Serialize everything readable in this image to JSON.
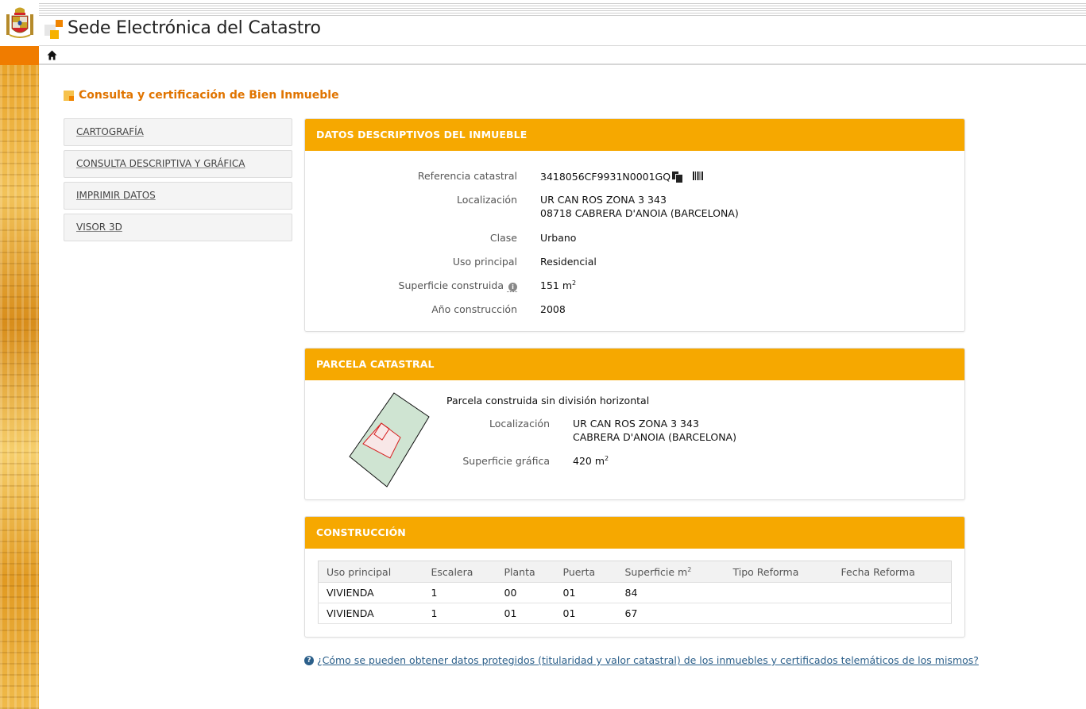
{
  "header": {
    "site_title": "Sede Electrónica del Catastro",
    "home_icon": "home-icon",
    "emblem": "spain-coat-of-arms-icon"
  },
  "page": {
    "title": "Consulta y certificación de Bien Inmueble"
  },
  "side_menu": {
    "items": [
      {
        "label": "CARTOGRAFÍA"
      },
      {
        "label": "CONSULTA DESCRIPTIVA Y GRÁFICA"
      },
      {
        "label": "IMPRIMIR DATOS"
      },
      {
        "label": "VISOR 3D"
      }
    ]
  },
  "datos": {
    "heading": "DATOS DESCRIPTIVOS DEL INMUEBLE",
    "ref_label": "Referencia catastral",
    "ref_value": "3418056CF9931N0001GQ",
    "loc_label": "Localización",
    "loc_line1": "UR CAN ROS ZONA 3 343",
    "loc_line2": "08718 CABRERA D'ANOIA (BARCELONA)",
    "clase_label": "Clase",
    "clase_value": "Urbano",
    "uso_label": "Uso principal",
    "uso_value": "Residencial",
    "sup_label": "Superficie construida",
    "sup_value": "151 m",
    "sup_unit_exp": "2",
    "anio_label": "Año construcción",
    "anio_value": "2008"
  },
  "parcela": {
    "heading": "PARCELA CATASTRAL",
    "tipo": "Parcela construida sin división horizontal",
    "loc_label": "Localización",
    "loc_line1": "UR CAN ROS ZONA 3 343",
    "loc_line2": "CABRERA D'ANOIA (BARCELONA)",
    "sup_label": "Superficie gráfica",
    "sup_value": "420 m",
    "sup_unit_exp": "2"
  },
  "construccion": {
    "heading": "CONSTRUCCIÓN",
    "columns": [
      "Uso principal",
      "Escalera",
      "Planta",
      "Puerta",
      "Superficie m",
      "Tipo Reforma",
      "Fecha Reforma"
    ],
    "sup_col_exp": "2",
    "rows": [
      [
        "VIVIENDA",
        "1",
        "00",
        "01",
        "84",
        "",
        ""
      ],
      [
        "VIVIENDA",
        "1",
        "01",
        "01",
        "67",
        "",
        ""
      ]
    ]
  },
  "help": {
    "text": "¿Cómo se pueden obtener datos protegidos (titularidad y valor catastral) de los inmuebles y certificados telemáticos de los mismos?"
  },
  "colors": {
    "accent": "#f6a800",
    "title": "#e07400",
    "link": "#2b5f8a"
  }
}
